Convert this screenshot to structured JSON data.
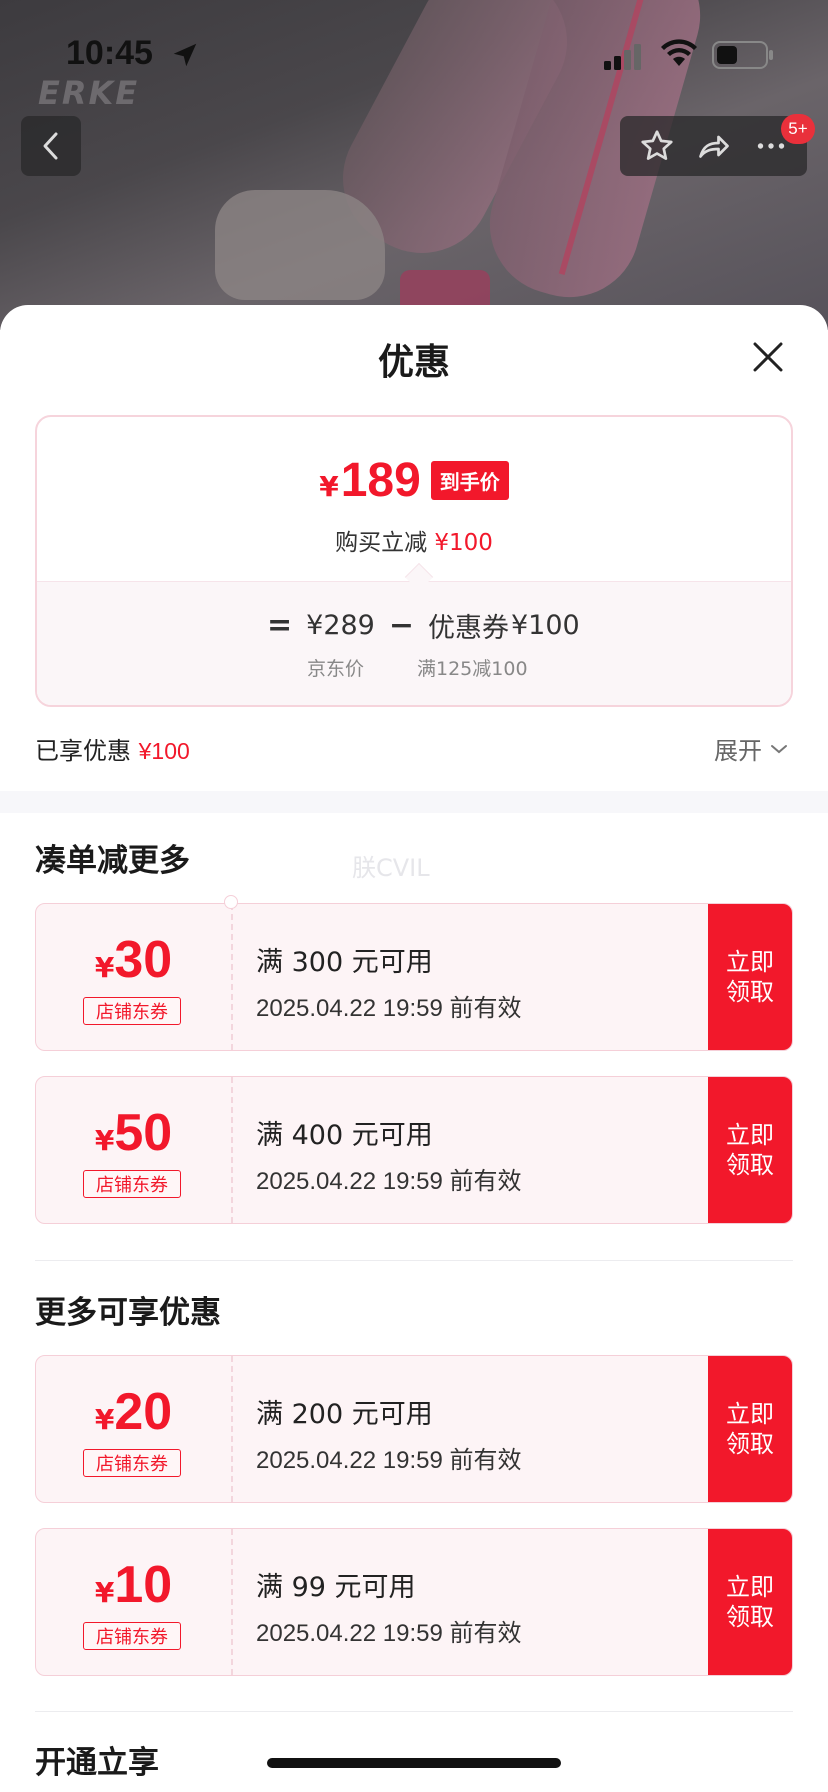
{
  "status_bar": {
    "time": "10:45"
  },
  "background": {
    "brand": "ERKE"
  },
  "nav": {
    "badge": "5+"
  },
  "sheet": {
    "title": "优惠"
  },
  "price_card": {
    "currency": "¥",
    "final_price": "189",
    "final_tag": "到手价",
    "reduce_text": "购买立减",
    "reduce_amount": "¥100",
    "eq": "=",
    "jd_price": "¥289",
    "minus": "−",
    "coupon_label": "优惠券",
    "coupon_amount": "¥100",
    "jd_price_label": "京东价",
    "coupon_rule": "满125减100"
  },
  "enjoyed": {
    "label": "已享优惠",
    "amount": "¥100",
    "expand": "展开"
  },
  "sections": [
    {
      "title": "凑单减更多"
    },
    {
      "title": "更多可享优惠"
    },
    {
      "title": "开通立享"
    }
  ],
  "watermark": "朕CVIL",
  "coupons": [
    {
      "currency": "¥",
      "amount": "30",
      "type": "店铺东券",
      "condition": "满 300 元可用",
      "validity": "2025.04.22 19:59 前有效",
      "claim": "立即领取"
    },
    {
      "currency": "¥",
      "amount": "50",
      "type": "店铺东券",
      "condition": "满 400 元可用",
      "validity": "2025.04.22 19:59 前有效",
      "claim": "立即领取"
    },
    {
      "currency": "¥",
      "amount": "20",
      "type": "店铺东券",
      "condition": "满 200 元可用",
      "validity": "2025.04.22 19:59 前有效",
      "claim": "立即领取"
    },
    {
      "currency": "¥",
      "amount": "10",
      "type": "店铺东券",
      "condition": "满 99 元可用",
      "validity": "2025.04.22 19:59 前有效",
      "claim": "立即领取"
    }
  ],
  "colors": {
    "accent": "#f2182b",
    "coupon_bg": "#fdf4f6",
    "coupon_border": "#f5cfd8"
  },
  "icons": [
    "location-arrow-icon",
    "signal-icon",
    "wifi-icon",
    "battery-icon",
    "back-chevron-icon",
    "star-icon",
    "share-icon",
    "more-icon",
    "close-icon",
    "chevron-down-icon"
  ]
}
